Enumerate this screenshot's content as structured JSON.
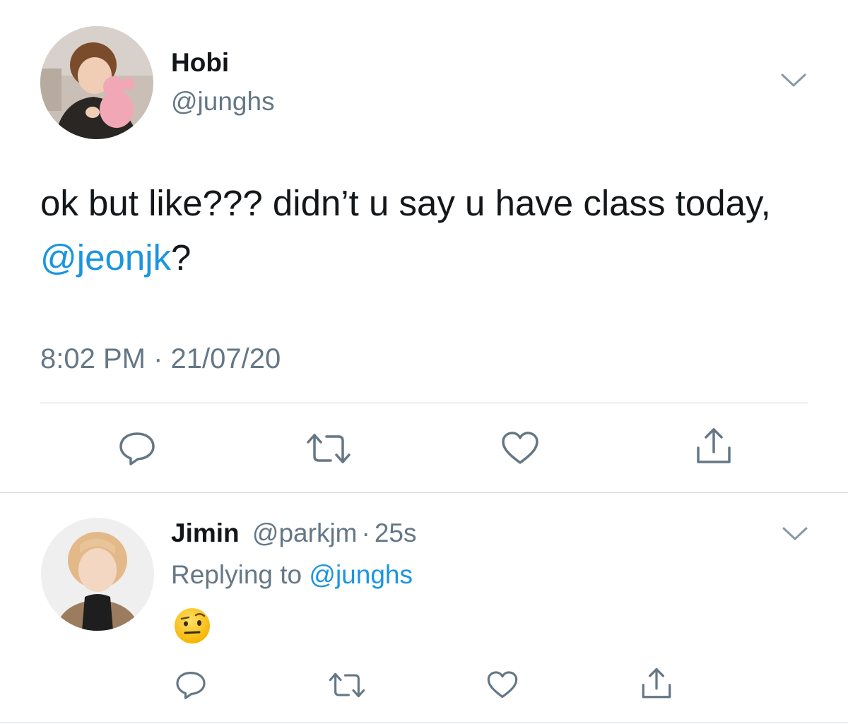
{
  "colors": {
    "accent": "#1b95e0",
    "text": "#14171a",
    "muted": "#657786",
    "divider": "#ccd6dd"
  },
  "main_tweet": {
    "display_name": "Hobi",
    "handle": "@junghs",
    "text_before": "ok but like??? didn’t u say u have class today, ",
    "mention": "@jeonjk",
    "text_after": "?",
    "timestamp": "8:02 PM · 21/07/20",
    "actions": [
      "reply-icon",
      "retweet-icon",
      "like-icon",
      "share-icon"
    ]
  },
  "reply": {
    "display_name": "Jimin",
    "handle": "@parkjm",
    "separator": "·",
    "time": "25s",
    "replying_label": "Replying to ",
    "replying_to": "@junghs",
    "content_emoji": "raised-eyebrow-emoji",
    "actions": [
      "reply-icon",
      "retweet-icon",
      "like-icon",
      "share-icon"
    ]
  }
}
